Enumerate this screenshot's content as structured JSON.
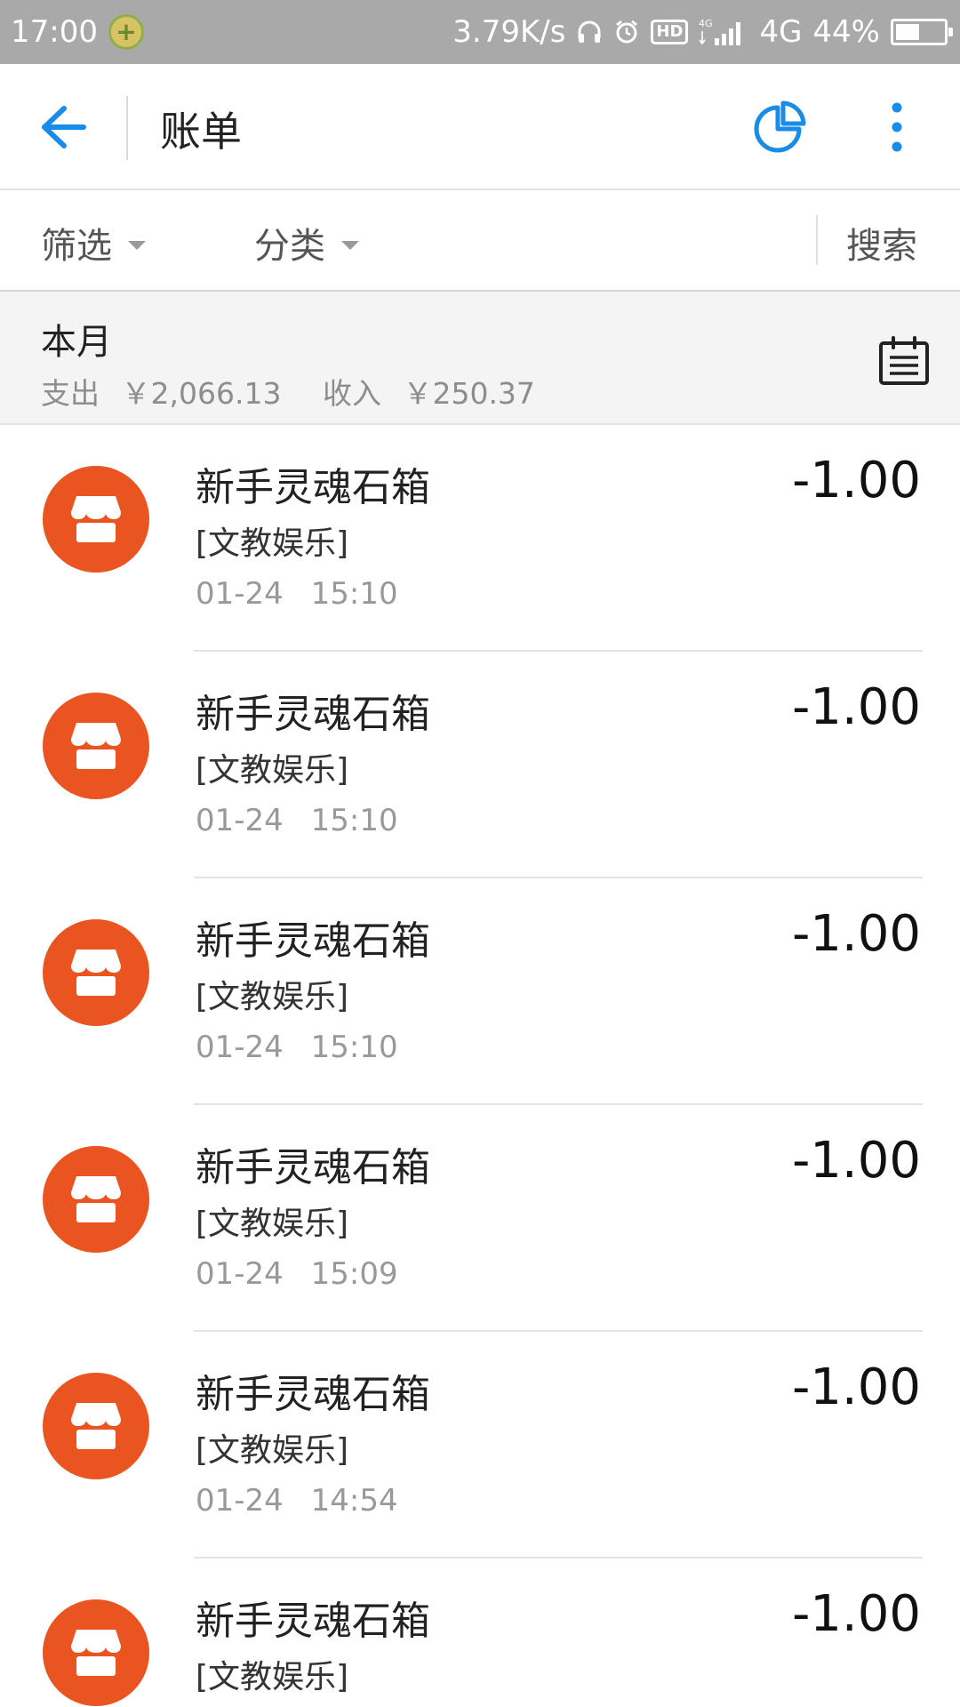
{
  "status_bar": {
    "time": "17:00",
    "net_speed": "3.79K/s",
    "hd_label": "HD",
    "network_small": "4G",
    "network": "4G",
    "battery_percent": "44%",
    "battery_level": 0.44
  },
  "toolbar": {
    "title": "账单"
  },
  "filters": {
    "filter_label": "筛选",
    "category_label": "分类",
    "search_label": "搜索"
  },
  "summary": {
    "period": "本月",
    "expense_label": "支出",
    "expense_value": "￥2,066.13",
    "income_label": "收入",
    "income_value": "￥250.37"
  },
  "bills": [
    {
      "name": "新手灵魂石箱",
      "category": "[文教娱乐]",
      "date": "01-24",
      "time": "15:10",
      "amount": "-1.00"
    },
    {
      "name": "新手灵魂石箱",
      "category": "[文教娱乐]",
      "date": "01-24",
      "time": "15:10",
      "amount": "-1.00"
    },
    {
      "name": "新手灵魂石箱",
      "category": "[文教娱乐]",
      "date": "01-24",
      "time": "15:10",
      "amount": "-1.00"
    },
    {
      "name": "新手灵魂石箱",
      "category": "[文教娱乐]",
      "date": "01-24",
      "time": "15:09",
      "amount": "-1.00"
    },
    {
      "name": "新手灵魂石箱",
      "category": "[文教娱乐]",
      "date": "01-24",
      "time": "14:54",
      "amount": "-1.00"
    },
    {
      "name": "新手灵魂石箱",
      "category": "[文教娱乐]",
      "date": "",
      "time": "",
      "amount": "-1.00"
    }
  ],
  "colors": {
    "accent": "#1a8be6",
    "category_icon_bg": "#ea5420",
    "status_bar_bg": "#a9a9a9"
  },
  "icons": {
    "back": "arrow-left-icon",
    "chart": "pie-chart-icon",
    "more": "more-vertical-icon",
    "calendar": "calendar-icon",
    "category": "shop-icon"
  }
}
